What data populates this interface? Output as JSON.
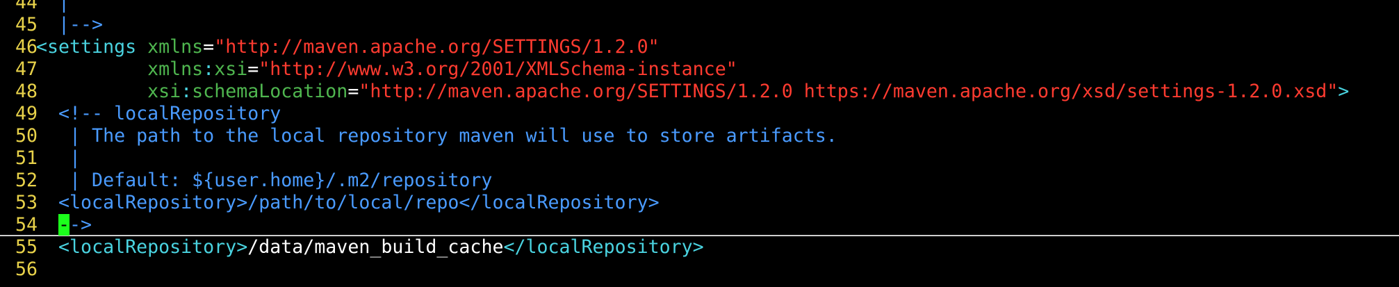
{
  "colors": {
    "background": "#000000",
    "line_number": "#e8d24a",
    "comment": "#4a9bff",
    "tag": "#4ad3e0",
    "attribute": "#4fb64f",
    "string": "#ff3b30",
    "plain": "#ffffff",
    "cursor": "#1cff1c"
  },
  "lines": [
    {
      "num": "44",
      "segments": [
        {
          "t": "comment",
          "v": "  |"
        }
      ]
    },
    {
      "num": "45",
      "segments": [
        {
          "t": "comment",
          "v": "  |-->"
        }
      ]
    },
    {
      "num": "46",
      "segments": [
        {
          "t": "tag",
          "v": "<settings "
        },
        {
          "t": "attr",
          "v": "xmlns"
        },
        {
          "t": "eq",
          "v": "="
        },
        {
          "t": "str",
          "v": "\"http://maven.apache.org/SETTINGS/1.2.0\""
        }
      ]
    },
    {
      "num": "47",
      "segments": [
        {
          "t": "plain",
          "v": "          "
        },
        {
          "t": "attr",
          "v": "xmlns"
        },
        {
          "t": "tag",
          "v": ":"
        },
        {
          "t": "attr",
          "v": "xsi"
        },
        {
          "t": "eq",
          "v": "="
        },
        {
          "t": "str",
          "v": "\"http://www.w3.org/2001/XMLSchema-instance\""
        }
      ]
    },
    {
      "num": "48",
      "segments": [
        {
          "t": "plain",
          "v": "          "
        },
        {
          "t": "attr",
          "v": "xsi"
        },
        {
          "t": "tag",
          "v": ":"
        },
        {
          "t": "attr",
          "v": "schemaLocation"
        },
        {
          "t": "eq",
          "v": "="
        },
        {
          "t": "str",
          "v": "\"http://maven.apache.org/SETTINGS/1.2.0 https://maven.apache.org/xsd/settings-1.2.0.xsd\""
        },
        {
          "t": "tag",
          "v": ">"
        }
      ]
    },
    {
      "num": "49",
      "segments": [
        {
          "t": "comment",
          "v": "  <!-- localRepository"
        }
      ]
    },
    {
      "num": "50",
      "segments": [
        {
          "t": "comment",
          "v": "   | The path to the local repository maven will use to store artifacts."
        }
      ]
    },
    {
      "num": "51",
      "segments": [
        {
          "t": "comment",
          "v": "   |"
        }
      ]
    },
    {
      "num": "52",
      "segments": [
        {
          "t": "comment",
          "v": "   | Default: ${user.home}/.m2/repository"
        }
      ]
    },
    {
      "num": "53",
      "segments": [
        {
          "t": "comment",
          "v": "  <localRepository>/path/to/local/repo</localRepository>"
        }
      ]
    },
    {
      "num": "54",
      "cursorline": true,
      "segments": [
        {
          "t": "plain",
          "v": "  "
        },
        {
          "t": "cursor",
          "v": "-"
        },
        {
          "t": "comment",
          "v": "->"
        }
      ]
    },
    {
      "num": "55",
      "segments": [
        {
          "t": "plain",
          "v": "  "
        },
        {
          "t": "tag",
          "v": "<localRepository>"
        },
        {
          "t": "plain",
          "v": "/data/maven_build_cache"
        },
        {
          "t": "tag",
          "v": "</localRepository>"
        }
      ]
    },
    {
      "num": "56",
      "segments": []
    }
  ]
}
